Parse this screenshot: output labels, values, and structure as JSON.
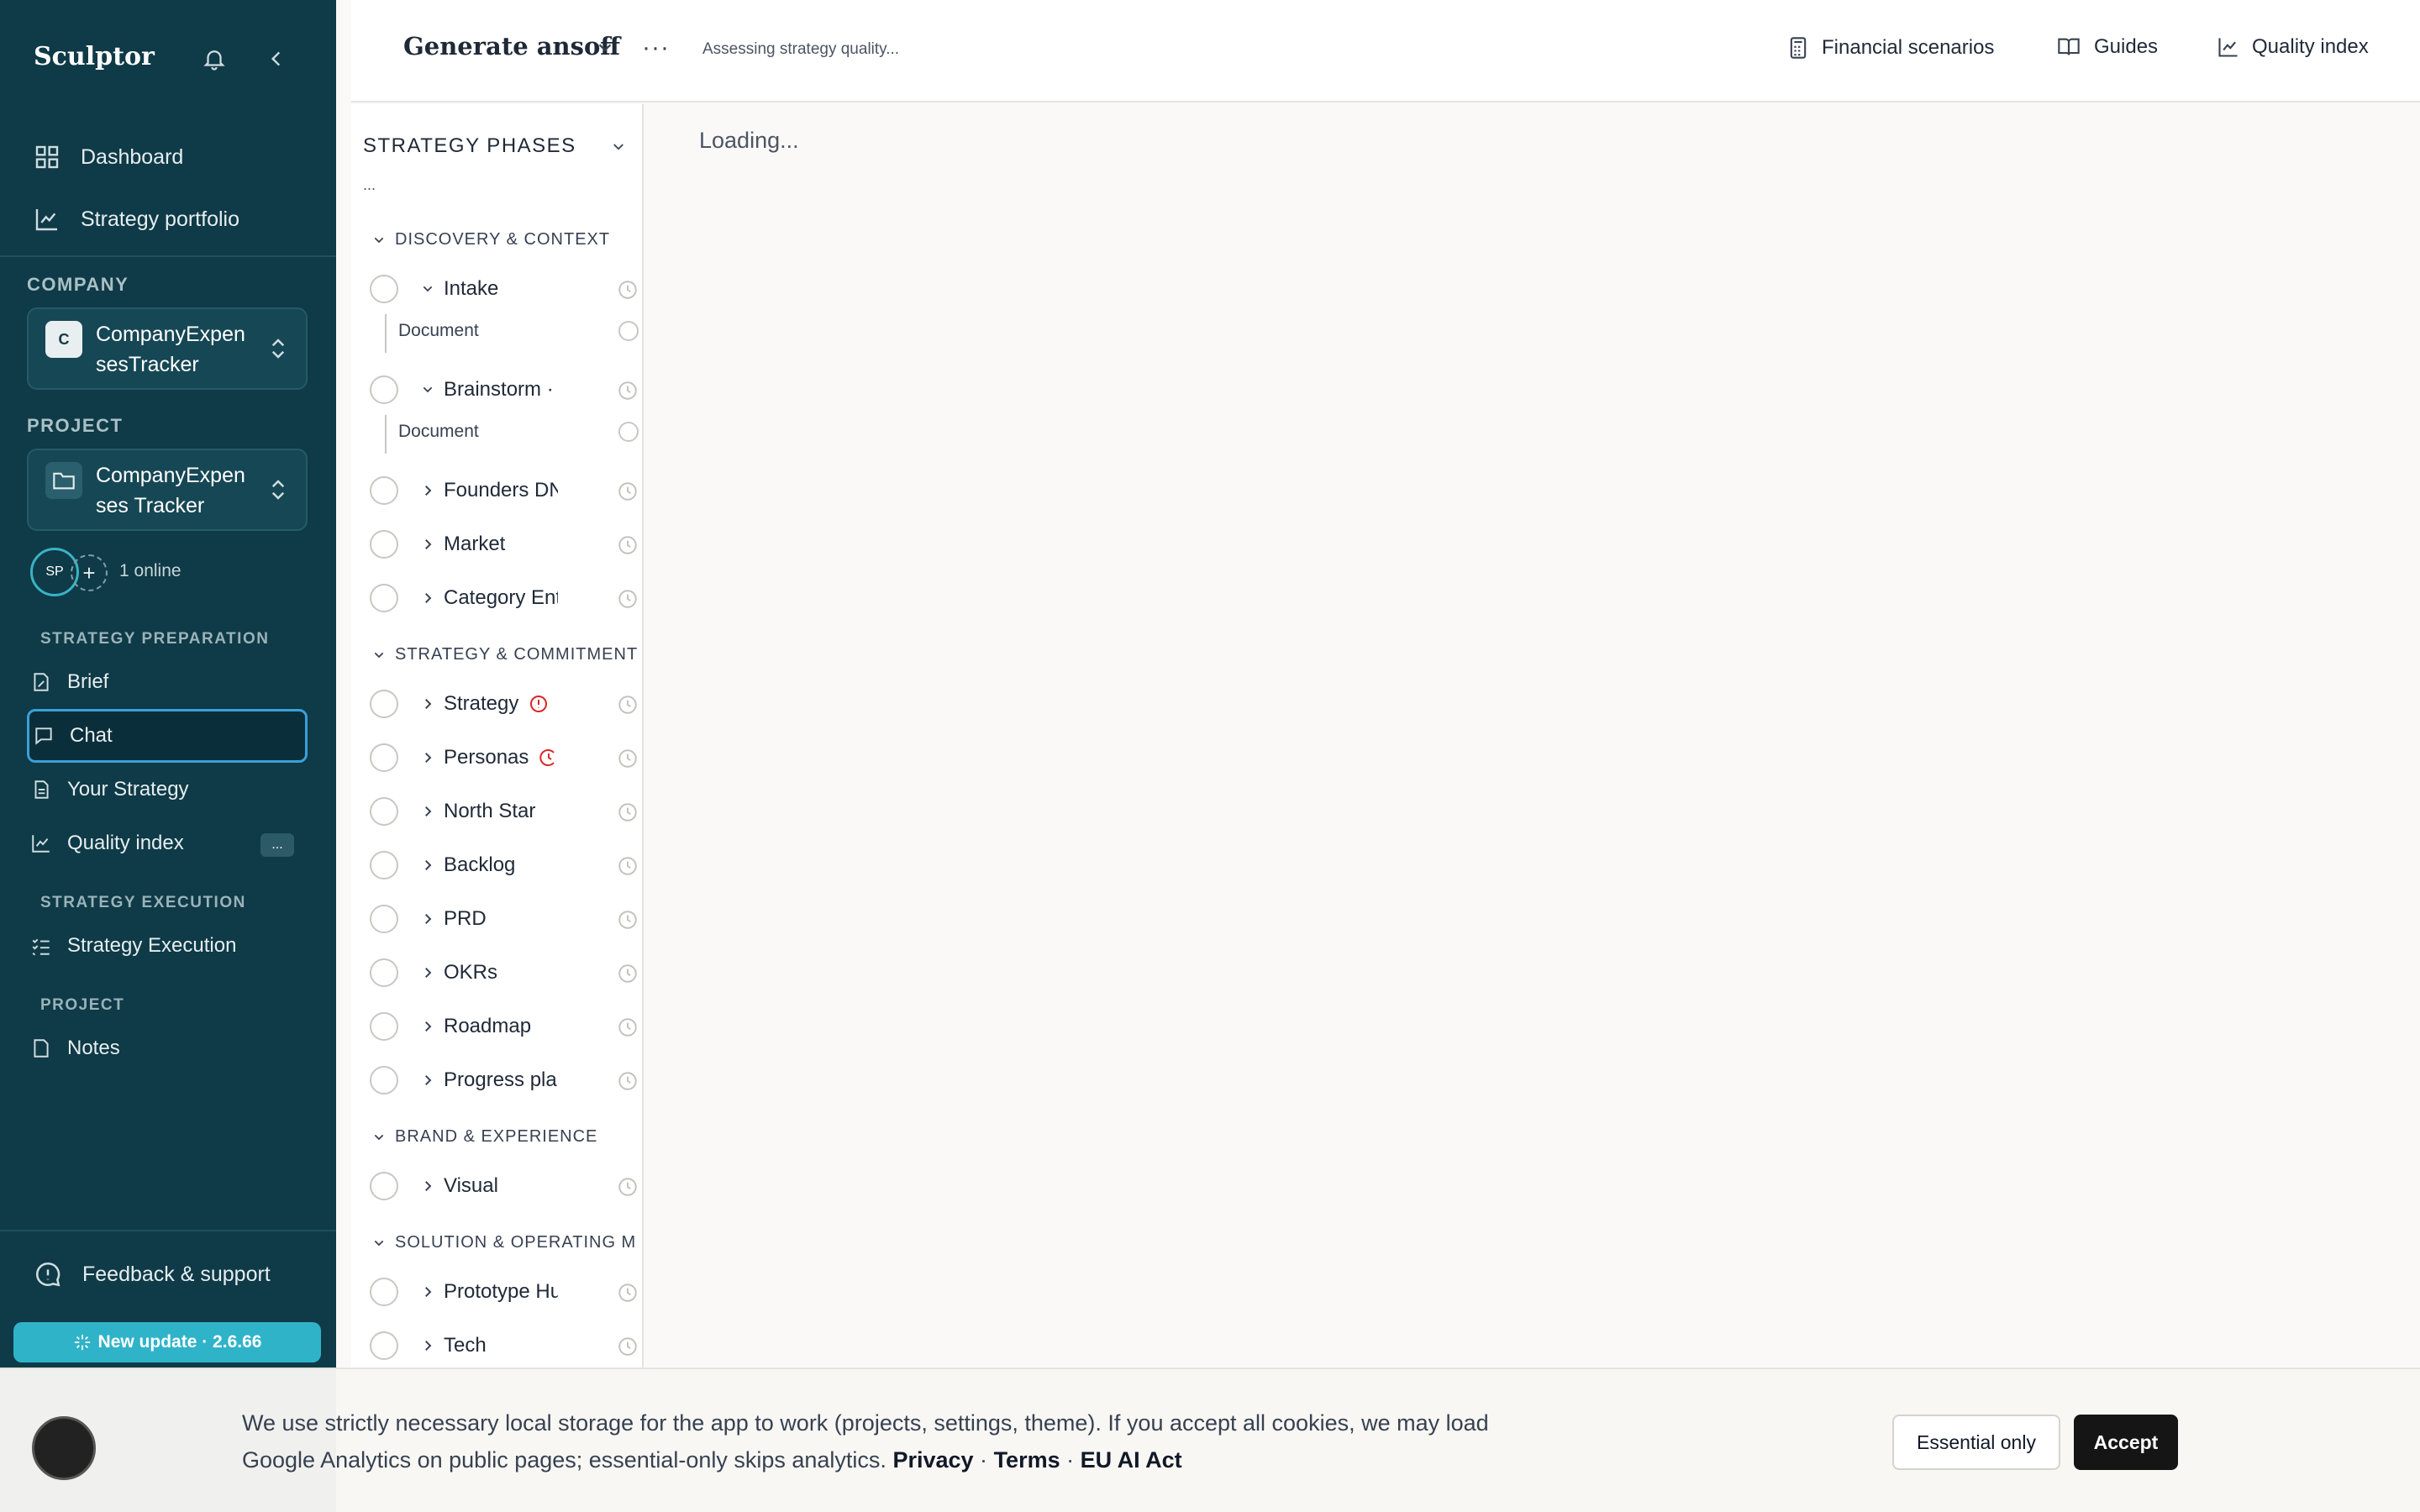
{
  "sidebar": {
    "brand": "Sculptor",
    "nav_top": [
      {
        "label": "Dashboard",
        "icon": "grid-icon"
      },
      {
        "label": "Strategy portfolio",
        "icon": "chart-line-icon"
      }
    ],
    "company_label": "COMPANY",
    "company_badge": "C",
    "company_name": "CompanyExpensesTracker",
    "project_label": "PROJECT",
    "project_name": "CompanyExpenses Tracker",
    "avatar_initials": "SP",
    "add_symbol": "+",
    "online_text": "1 online",
    "prep_label": "STRATEGY PREPARATION",
    "prep_items": [
      {
        "label": "Brief"
      },
      {
        "label": "Chat"
      },
      {
        "label": "Your Strategy"
      },
      {
        "label": "Quality index",
        "badge": "..."
      }
    ],
    "exec_label": "STRATEGY EXECUTION",
    "exec_items": [
      {
        "label": "Strategy Execution"
      }
    ],
    "project_section_label": "PROJECT",
    "project_items": [
      {
        "label": "Notes"
      }
    ],
    "feedback_label": "Feedback & support",
    "update_label": "New update · 2.6.66"
  },
  "topbar": {
    "title": "Generate ansoff",
    "more": "···",
    "status": "Assessing strategy quality...",
    "links": [
      {
        "label": "Financial scenarios",
        "icon": "calculator-icon"
      },
      {
        "label": "Guides",
        "icon": "book-icon"
      },
      {
        "label": "Quality index",
        "icon": "chart-line-icon"
      }
    ]
  },
  "phases": {
    "title": "STRATEGY PHASES",
    "ellipsis": "...",
    "groups": [
      {
        "label": "DISCOVERY & CONTEXT"
      },
      {
        "label": "STRATEGY & COMMITMENTS"
      },
      {
        "label": "BRAND & EXPERIENCE"
      },
      {
        "label": "SOLUTION & OPERATING MODEL"
      }
    ],
    "items": [
      {
        "label": "Intake"
      },
      {
        "label": "Brainstorm ·"
      },
      {
        "label": "Founders DNA"
      },
      {
        "label": "Market"
      },
      {
        "label": "Category Entry"
      },
      {
        "label": "Strategy"
      },
      {
        "label": "Personas"
      },
      {
        "label": "North Star"
      },
      {
        "label": "Backlog"
      },
      {
        "label": "PRD"
      },
      {
        "label": "OKRs"
      },
      {
        "label": "Roadmap"
      },
      {
        "label": "Progress plan"
      },
      {
        "label": "Visual"
      },
      {
        "label": "Prototype Hub"
      },
      {
        "label": "Tech"
      }
    ],
    "doc_label": "Document"
  },
  "main": {
    "loading": "Loading..."
  },
  "cookie": {
    "text": "We use strictly necessary local storage for the app to work (projects, settings, theme). If you accept all cookies, we may load Google Analytics on public pages; essential-only skips analytics.",
    "privacy": "Privacy",
    "terms": "Terms",
    "ai_act": "EU AI Act",
    "sep": "·",
    "essential_label": "Essential only",
    "accept_label": "Accept"
  },
  "colors": {
    "sidebar_bg": "#0f3a47",
    "accent": "#2fb3c9",
    "alert": "#dc2626"
  }
}
